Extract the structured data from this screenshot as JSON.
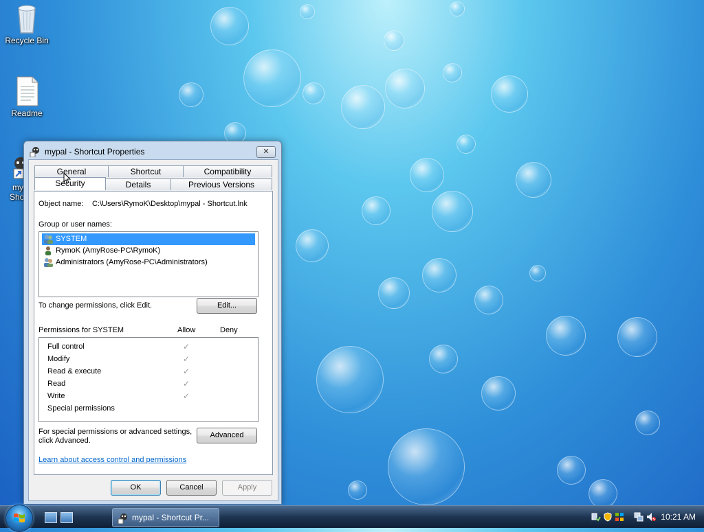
{
  "desktop": {
    "icons": [
      {
        "label": "Recycle Bin"
      },
      {
        "label": "Readme"
      },
      {
        "label": "my"
      },
      {
        "label": "Sho"
      }
    ]
  },
  "window": {
    "title": "mypal - Shortcut Properties",
    "close_glyph": "✕",
    "tabs_row1": [
      "General",
      "Shortcut",
      "Compatibility"
    ],
    "tabs_row2": [
      "Security",
      "Details",
      "Previous Versions"
    ],
    "active_tab": "Security",
    "object_name_label": "Object name:",
    "object_name_value": "C:\\Users\\RymoK\\Desktop\\mypal - Shortcut.lnk",
    "group_label": "Group or user names:",
    "users": [
      {
        "name": "SYSTEM",
        "selected": true
      },
      {
        "name": "RymoK (AmyRose-PC\\RymoK)",
        "selected": false
      },
      {
        "name": "Administrators (AmyRose-PC\\Administrators)",
        "selected": false
      }
    ],
    "change_perm_text": "To change permissions, click Edit.",
    "edit_button": "Edit...",
    "permissions_for": "Permissions for SYSTEM",
    "allow_header": "Allow",
    "deny_header": "Deny",
    "permissions": [
      {
        "name": "Full control",
        "allow": true
      },
      {
        "name": "Modify",
        "allow": true
      },
      {
        "name": "Read & execute",
        "allow": true
      },
      {
        "name": "Read",
        "allow": true
      },
      {
        "name": "Write",
        "allow": true
      },
      {
        "name": "Special permissions",
        "allow": false
      }
    ],
    "check_glyph": "✓",
    "special_text_1": "For special permissions or advanced settings,",
    "special_text_2": "click Advanced.",
    "advanced_button": "Advanced",
    "learn_link": "Learn about access control and permissions",
    "ok_button": "OK",
    "cancel_button": "Cancel",
    "apply_button": "Apply"
  },
  "taskbar": {
    "task_label": "mypal - Shortcut Pr...",
    "clock": "10:21 AM"
  },
  "colors": {
    "selection": "#3399ff",
    "link": "#0066cc"
  }
}
